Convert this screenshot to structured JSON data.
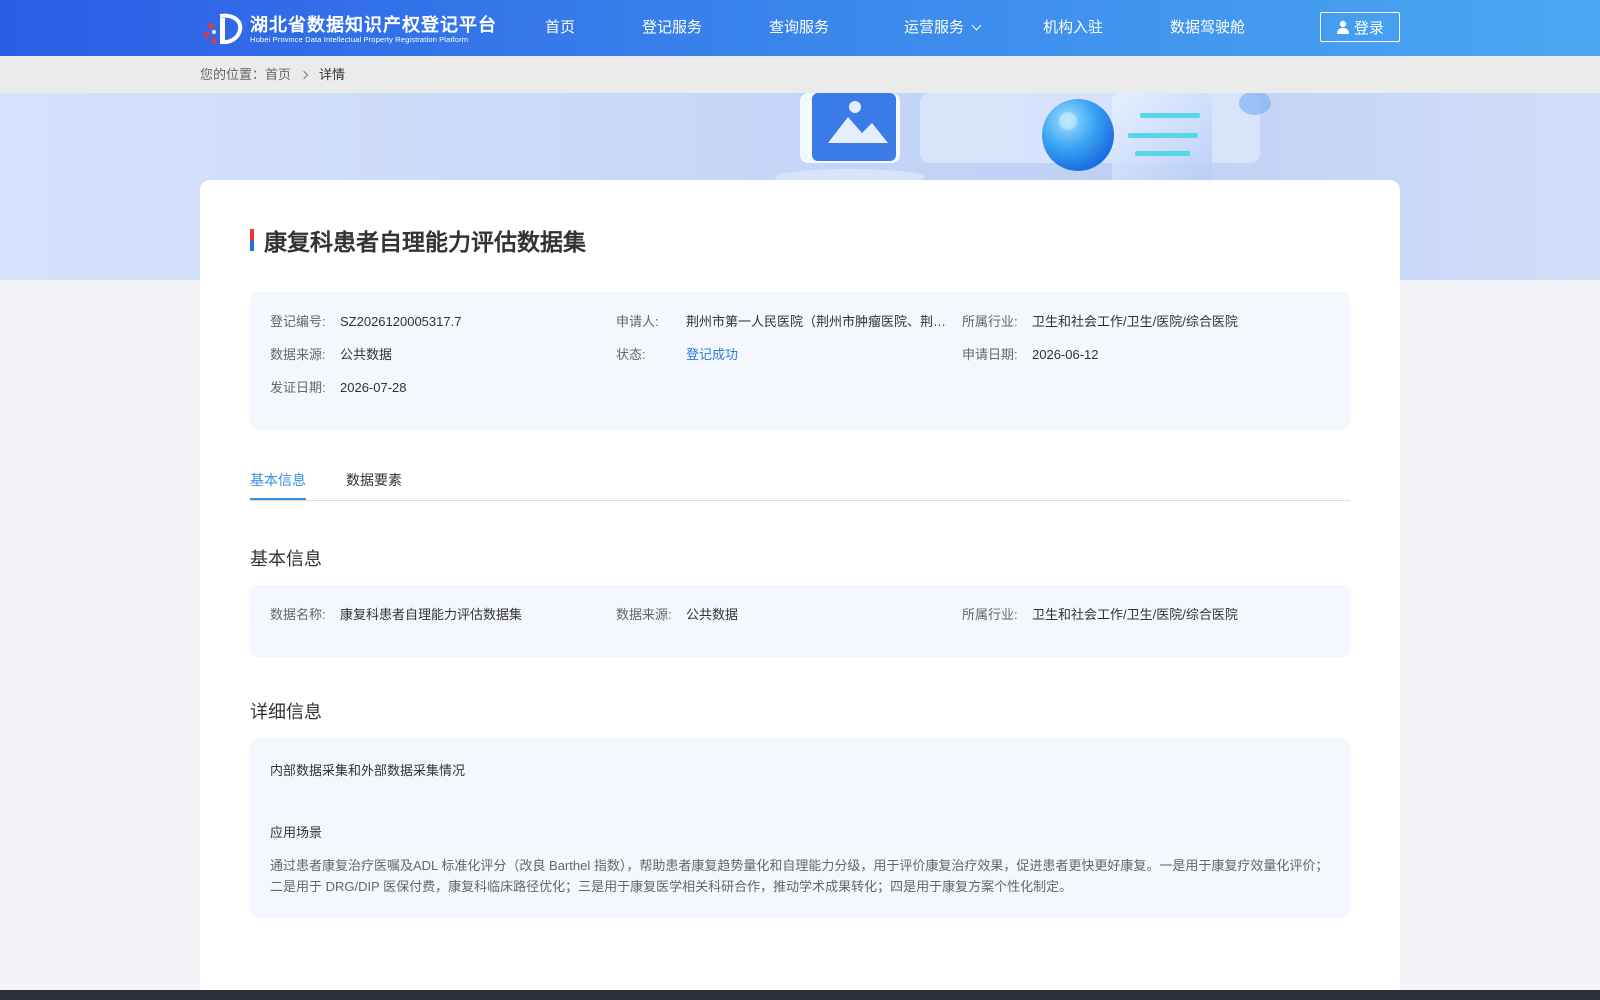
{
  "header": {
    "logo_cn": "湖北省数据知识产权登记平台",
    "logo_en": "Hubei Province Data Intellectual Property Registration Platform",
    "nav": [
      "首页",
      "登记服务",
      "查询服务",
      "运营服务",
      "机构入驻",
      "数据驾驶舱"
    ],
    "login": "登录"
  },
  "breadcrumb": {
    "prefix": "您的位置：",
    "home": "首页",
    "current": "详情"
  },
  "record": {
    "title": "康复科患者自理能力评估数据集",
    "fields": [
      {
        "label": "登记编号:",
        "value": "SZ2026120005317.7"
      },
      {
        "label": "申请人:",
        "value": "荆州市第一人民医院（荆州市肿瘤医院、荆州市第一人民医院医疗集团）"
      },
      {
        "label": "所属行业:",
        "value": "卫生和社会工作/卫生/医院/综合医院"
      },
      {
        "label": "数据来源:",
        "value": "公共数据"
      },
      {
        "label": "状态:",
        "value": "登记成功"
      },
      {
        "label": "申请日期:",
        "value": "2026-06-12"
      },
      {
        "label": "发证日期:",
        "value": "2026-07-28"
      }
    ]
  },
  "tabs": [
    "基本信息",
    "数据要素"
  ],
  "basic": {
    "title": "基本信息",
    "fields": [
      {
        "label": "数据名称:",
        "value": "康复科患者自理能力评估数据集"
      },
      {
        "label": "数据来源:",
        "value": "公共数据"
      },
      {
        "label": "所属行业:",
        "value": "卫生和社会工作/卫生/医院/综合医院"
      }
    ]
  },
  "detail": {
    "title": "详细信息",
    "collection_label": "内部数据采集和外部数据采集情况",
    "scenario_label": "应用场景",
    "scenario_text": "通过患者康复治疗医嘱及ADL 标准化评分（改良 Barthel 指数），帮助患者康复趋势量化和自理能力分级，用于评价康复治疗效果，促进患者更快更好康复。一是用于康复疗效量化评价；二是用于 DRG/DIP 医保付费，康复科临床路径优化；三是用于康复医学相关科研合作，推动学术成果转化；四是用于康复方案个性化制定。"
  },
  "colors": {
    "header_start": "#2b5de6",
    "header_end": "#4aa8f1",
    "accent": "#3a8ee6",
    "status_success": "#2a7de1",
    "panel_bg": "#f4f7fe"
  }
}
